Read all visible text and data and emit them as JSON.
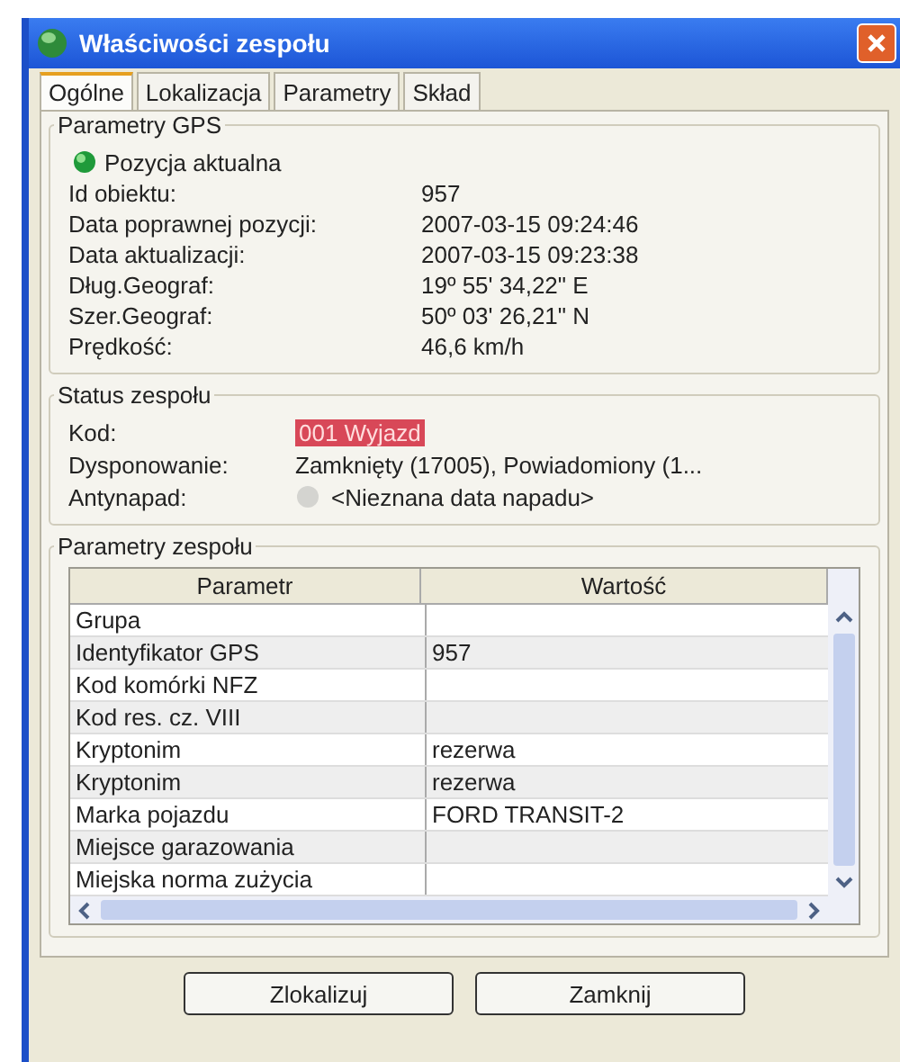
{
  "window": {
    "title": "Właściwości zespołu"
  },
  "tabs": [
    {
      "label": "Ogólne",
      "selected": true
    },
    {
      "label": "Lokalizacja",
      "selected": false
    },
    {
      "label": "Parametry",
      "selected": false
    },
    {
      "label": "Skład",
      "selected": false
    }
  ],
  "gps": {
    "title": "Parametry GPS",
    "position": "Pozycja aktualna",
    "fields": [
      {
        "label": "Id obiektu:",
        "value": "957"
      },
      {
        "label": "Data poprawnej pozycji:",
        "value": "2007-03-15 09:24:46"
      },
      {
        "label": "Data aktualizacji:",
        "value": "2007-03-15 09:23:38"
      },
      {
        "label": "Dług.Geograf:",
        "value": "19º 55' 34,22\" E"
      },
      {
        "label": "Szer.Geograf:",
        "value": "50º 03' 26,21\" N"
      },
      {
        "label": "Prędkość:",
        "value": "46,6 km/h"
      }
    ]
  },
  "status": {
    "title": "Status zespołu",
    "code_label": "Kod:",
    "code_value": "001 Wyjazd",
    "dispatch_label": "Dysponowanie:",
    "dispatch_value": "Zamknięty (17005), Powiadomiony (1...",
    "alarm_label": "Antynapad:",
    "alarm_value": "<Nieznana data napadu>"
  },
  "params": {
    "title": "Parametry zespołu",
    "columns": [
      "Parametr",
      "Wartość"
    ],
    "rows": [
      {
        "parameter": "Grupa"
      },
      {
        "parameter": "Identyfikator GPS",
        "value": "957"
      },
      {
        "parameter": "Kod komórki NFZ"
      },
      {
        "parameter": "Kod res. cz. VIII"
      },
      {
        "parameter": "Kryptonim",
        "value": "rezerwa"
      },
      {
        "parameter": "Kryptonim",
        "value": "rezerwa"
      },
      {
        "parameter": "Marka pojazdu",
        "value": "FORD TRANSIT-2"
      },
      {
        "parameter": "Miejsce garazowania"
      },
      {
        "parameter": "Miejska norma zużycia"
      }
    ]
  },
  "buttons": [
    "Zlokalizuj",
    "Zamknij"
  ]
}
